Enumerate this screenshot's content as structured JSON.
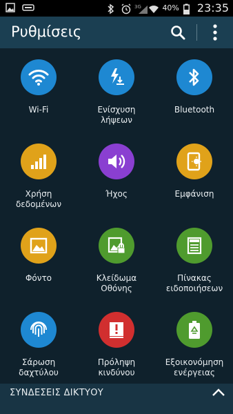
{
  "status_bar": {
    "battery": "40%",
    "time": "23:35",
    "network": "3G"
  },
  "app_bar": {
    "title": "Ρυθμίσεις"
  },
  "tiles": [
    {
      "label": "Wi-Fi",
      "color": "#1e88d2",
      "icon": "wifi-icon"
    },
    {
      "label": "Ενίσχυση\nλήψεων",
      "color": "#1e88d2",
      "icon": "download-booster-icon"
    },
    {
      "label": "Bluetooth",
      "color": "#1e88d2",
      "icon": "bluetooth-icon"
    },
    {
      "label": "Χρήση\nδεδομένων",
      "color": "#e0a21a",
      "icon": "data-usage-icon"
    },
    {
      "label": "Ήχος",
      "color": "#8a3fd1",
      "icon": "sound-icon"
    },
    {
      "label": "Εμφάνιση",
      "color": "#e0a21a",
      "icon": "display-icon"
    },
    {
      "label": "Φόντο",
      "color": "#e0a21a",
      "icon": "wallpaper-icon"
    },
    {
      "label": "Κλείδωμα\nΟθόνης",
      "color": "#4f9b2e",
      "icon": "lock-screen-icon"
    },
    {
      "label": "Πίνακας\nειδοποιήσεων",
      "color": "#4f9b2e",
      "icon": "notification-panel-icon"
    },
    {
      "label": "Σάρωση\nδαχτύλου",
      "color": "#1e88d2",
      "icon": "fingerprint-icon"
    },
    {
      "label": "Πρόληψη\nκινδύνου",
      "color": "#d12f2f",
      "icon": "emergency-icon"
    },
    {
      "label": "Εξοικονόμηση\nενέργειας",
      "color": "#4f9b2e",
      "icon": "power-saving-icon"
    }
  ],
  "bottom_bar": {
    "label": "ΣΥΝΔΕΣΕΙΣ ΔΙΚΤΥΟΥ"
  }
}
